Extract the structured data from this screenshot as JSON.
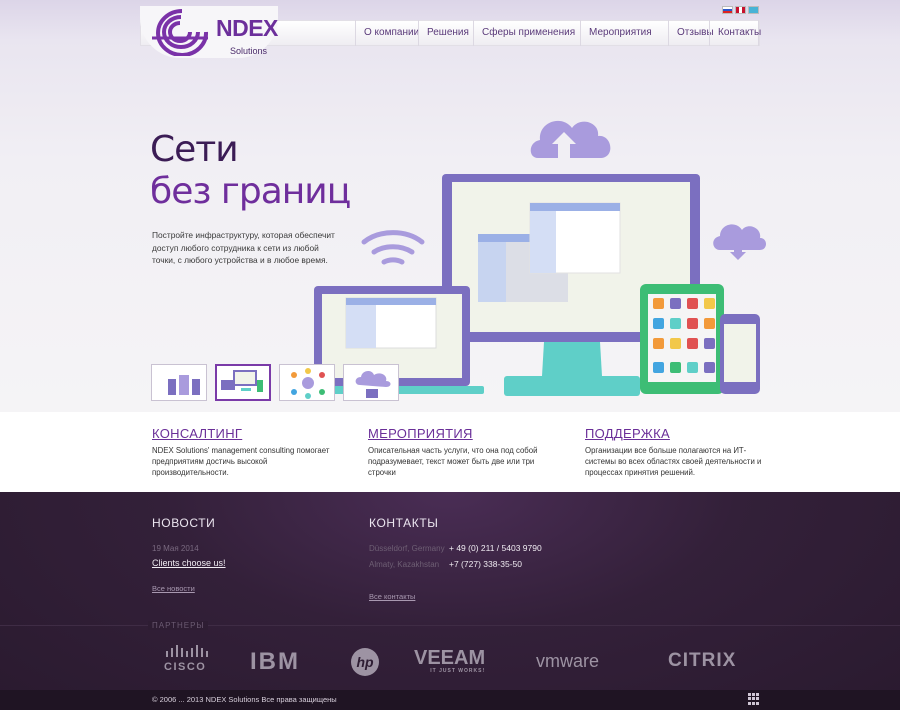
{
  "brand": {
    "name": "NDEX",
    "sub": "Solutions"
  },
  "languages": [
    "ru",
    "en",
    "kz"
  ],
  "nav": {
    "items": [
      {
        "label": "О компании"
      },
      {
        "label": "Решения"
      },
      {
        "label": "Сферы применения"
      },
      {
        "label": "Мероприятия"
      },
      {
        "label": "Отзывы"
      },
      {
        "label": "Контакты"
      }
    ]
  },
  "hero": {
    "title_line1": "Сети",
    "title_line2": "без границ",
    "description": "Постройте инфраструктуру, которая обеспечит доступ любого сотрудника к сети из любой точки, с любого устройства и в любое время.",
    "slides_count": 4,
    "active_slide": 2
  },
  "features": [
    {
      "title": "КОНСАЛТИНГ",
      "text": "NDEX Solutions' management consulting помогает предприятиям достичь высокой производительности."
    },
    {
      "title": "МЕРОПРИЯТИЯ",
      "text": "Описательная часть услуги, что она под собой подразумевает, текст может быть две или три строчки"
    },
    {
      "title": "ПОДДЕРЖКА",
      "text": "Организации все больше полагаются на ИТ-системы во всех областях своей деятельности и процессах принятия решений."
    }
  ],
  "news": {
    "title": "НОВОСТИ",
    "date": "19 Мая 2014",
    "headline": "Clients choose us!",
    "all_link": "Все новости"
  },
  "contacts": {
    "title": "КОНТАКТЫ",
    "items": [
      {
        "city": "Düsseldorf, Germany",
        "phone": "+ 49 (0) 211 / 5403 9790"
      },
      {
        "city": "Almaty, Kazakhstan",
        "phone": "+7 (727) 338-35-50"
      }
    ],
    "all_link": "Все контакты"
  },
  "partners": {
    "label": "ПАРТНЕРЫ",
    "items": [
      "CISCO",
      "IBM",
      "hp",
      "VEEAM",
      "vmware",
      "CITRIX"
    ],
    "veeam_tag": "IT JUST WORKS!"
  },
  "footer": {
    "copyright": "© 2006 ... 2013 NDEX Solutions Все права защищены"
  }
}
